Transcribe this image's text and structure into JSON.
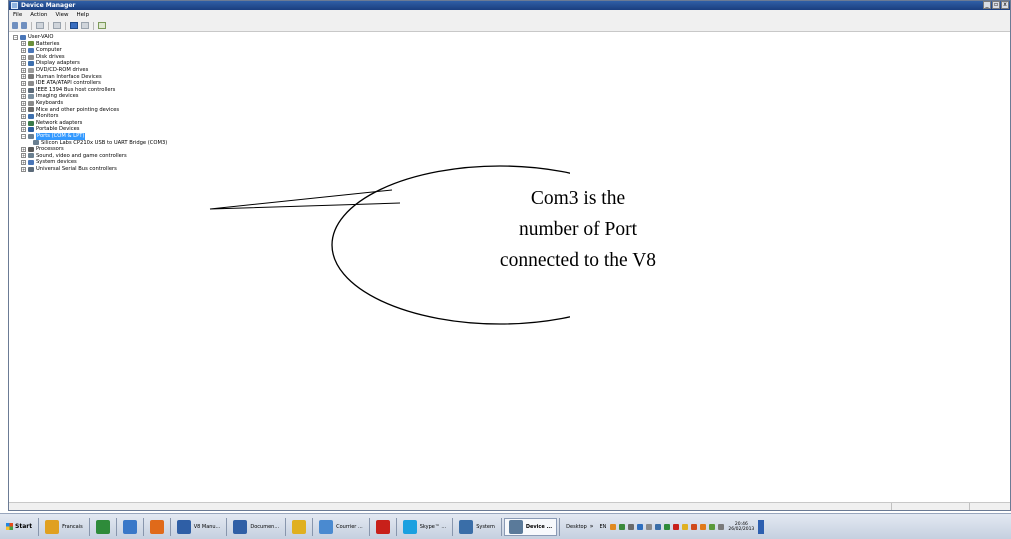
{
  "window": {
    "title": "Device Manager",
    "buttons": [
      "_",
      "▫",
      "x"
    ]
  },
  "menu": [
    "File",
    "Action",
    "View",
    "Help"
  ],
  "toolbar_icons": [
    "back-arrow-icon",
    "forward-arrow-icon",
    "properties-icon",
    "view-icon",
    "help-icon",
    "device-icon",
    "scan-icon"
  ],
  "tree": {
    "root": "User-VAIO",
    "items": [
      {
        "label": "Batteries",
        "icon_color": "#6b8f3a"
      },
      {
        "label": "Computer",
        "icon_color": "#4a76b8"
      },
      {
        "label": "Disk drives",
        "icon_color": "#8a8a8a"
      },
      {
        "label": "Display adapters",
        "icon_color": "#3d6fae"
      },
      {
        "label": "DVD/CD-ROM drives",
        "icon_color": "#9a9a9a"
      },
      {
        "label": "Human Interface Devices",
        "icon_color": "#7a7a7a"
      },
      {
        "label": "IDE ATA/ATAPI controllers",
        "icon_color": "#8c8c8c"
      },
      {
        "label": "IEEE 1394 Bus host controllers",
        "icon_color": "#5c6b7a"
      },
      {
        "label": "Imaging devices",
        "icon_color": "#7a8fa0"
      },
      {
        "label": "Keyboards",
        "icon_color": "#8a8a8a"
      },
      {
        "label": "Mice and other pointing devices",
        "icon_color": "#6a6a6a"
      },
      {
        "label": "Monitors",
        "icon_color": "#3d6fae"
      },
      {
        "label": "Network adapters",
        "icon_color": "#3a7a4a"
      },
      {
        "label": "Portable Devices",
        "icon_color": "#2f5f9f"
      },
      {
        "label": "Ports (COM & LPT)",
        "icon_color": "#6a7f90",
        "expanded": true,
        "selected": true,
        "children": [
          "Silicon Labs CP210x USB to UART Bridge (COM3)"
        ]
      },
      {
        "label": "Processors",
        "icon_color": "#5a5a5a"
      },
      {
        "label": "Sound, video and game controllers",
        "icon_color": "#6a7f90"
      },
      {
        "label": "System devices",
        "icon_color": "#4a76b8"
      },
      {
        "label": "Universal Serial Bus controllers",
        "icon_color": "#5c6b7a"
      }
    ]
  },
  "callout": {
    "lines": [
      "Com3 is the",
      "number of Port",
      "connected to the V8"
    ]
  },
  "taskbar": {
    "start": "Start",
    "tasks": [
      {
        "label": "Francais",
        "icon_color": "#e0a020"
      },
      {
        "label": "",
        "icon_color": "#2e8b3a"
      },
      {
        "label": "",
        "icon_color": "#3a78c8"
      },
      {
        "label": "",
        "icon_color": "#e06a1a"
      },
      {
        "label": "V8 Manu...",
        "icon_color": "#2f5fa6"
      },
      {
        "label": "Documen...",
        "icon_color": "#2f5fa6"
      },
      {
        "label": "",
        "icon_color": "#e0b020"
      },
      {
        "label": "Courrier ...",
        "icon_color": "#4a8ad0"
      },
      {
        "label": "",
        "icon_color": "#c8201a"
      },
      {
        "label": "Skype™ ...",
        "icon_color": "#1aa0e0"
      },
      {
        "label": "System",
        "icon_color": "#3a6ea8"
      },
      {
        "label": "Device ...",
        "icon_color": "#5a7a9a",
        "active": true
      }
    ],
    "desktop": "Desktop",
    "lang": "EN",
    "time": "20:46",
    "date": "26/02/2013"
  }
}
